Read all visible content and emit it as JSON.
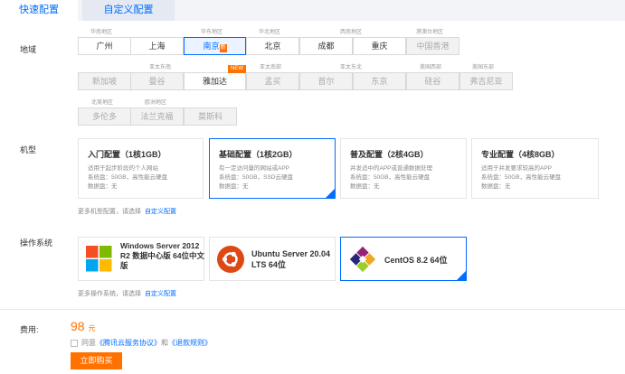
{
  "tabs": {
    "quick": "快速配置",
    "custom": "自定义配置"
  },
  "region": {
    "label": "地域",
    "row1": {
      "groups": [
        "华南地区",
        "华东地区",
        "华北地区",
        "西南地区",
        "港澳台地区"
      ],
      "buttons": [
        "广州",
        "上海",
        "南京",
        "北京",
        "成都",
        "重庆",
        "中国香港"
      ],
      "nanjing_tag": "新"
    },
    "row2": {
      "groups": [
        "亚太东南",
        "亚太南部",
        "亚太东北",
        "美国西部",
        "美国东部"
      ],
      "buttons": [
        "新加坡",
        "曼谷",
        "雅加达",
        "孟买",
        "首尔",
        "东京",
        "硅谷",
        "弗吉尼亚"
      ],
      "new_tag": "NEW"
    },
    "row3": {
      "groups": [
        "北美地区",
        "欧洲地区"
      ],
      "buttons": [
        "多伦多",
        "法兰克福",
        "莫斯科"
      ]
    }
  },
  "model": {
    "label": "机型",
    "cards": [
      {
        "title": "入门配置（1核1GB）",
        "lines": [
          "适用于起步阶段的个人网站",
          "系统盘：50GB，高性能云硬盘",
          "数据盘：无"
        ]
      },
      {
        "title": "基础配置（1核2GB）",
        "lines": [
          "有一定访问量的网站或APP",
          "系统盘：50GB，SSD云硬盘",
          "数据盘：无"
        ]
      },
      {
        "title": "普及配置（2核4GB）",
        "lines": [
          "并发适中的APP或普通数据处理",
          "系统盘：50GB，高性能云硬盘",
          "数据盘：无"
        ]
      },
      {
        "title": "专业配置（4核8GB）",
        "lines": [
          "适用于并发要求较高的APP",
          "系统盘：50GB，高性能云硬盘",
          "数据盘：无"
        ]
      }
    ],
    "hint": "更多机型配置，请选择",
    "hint_link": "自定义配置"
  },
  "os": {
    "label": "操作系统",
    "windows": {
      "line1": "Windows Server 2012",
      "line2": "R2 数据中心版 64位中文",
      "line3": "版"
    },
    "ubuntu": {
      "line1": "Ubuntu Server 20.04",
      "line2": "LTS 64位"
    },
    "centos": {
      "line1": "CentOS 8.2 64位"
    },
    "hint": "更多操作系统，请选择",
    "hint_link": "自定义配置",
    "icons": {
      "windows": "windows-logo-icon",
      "ubuntu": "ubuntu-logo-icon",
      "centos": "centos-logo-icon"
    }
  },
  "footer": {
    "fee_label": "费用:",
    "price": "98",
    "unit": "元",
    "agree_prefix": "同意",
    "agreement1": "《腾讯云服务协议》",
    "and": "和",
    "agreement2": "《退款规则》",
    "buy_button": "立即购买"
  },
  "colors": {
    "accent": "#006eff",
    "price": "#ff7200",
    "new_tag": "#ff7200"
  }
}
